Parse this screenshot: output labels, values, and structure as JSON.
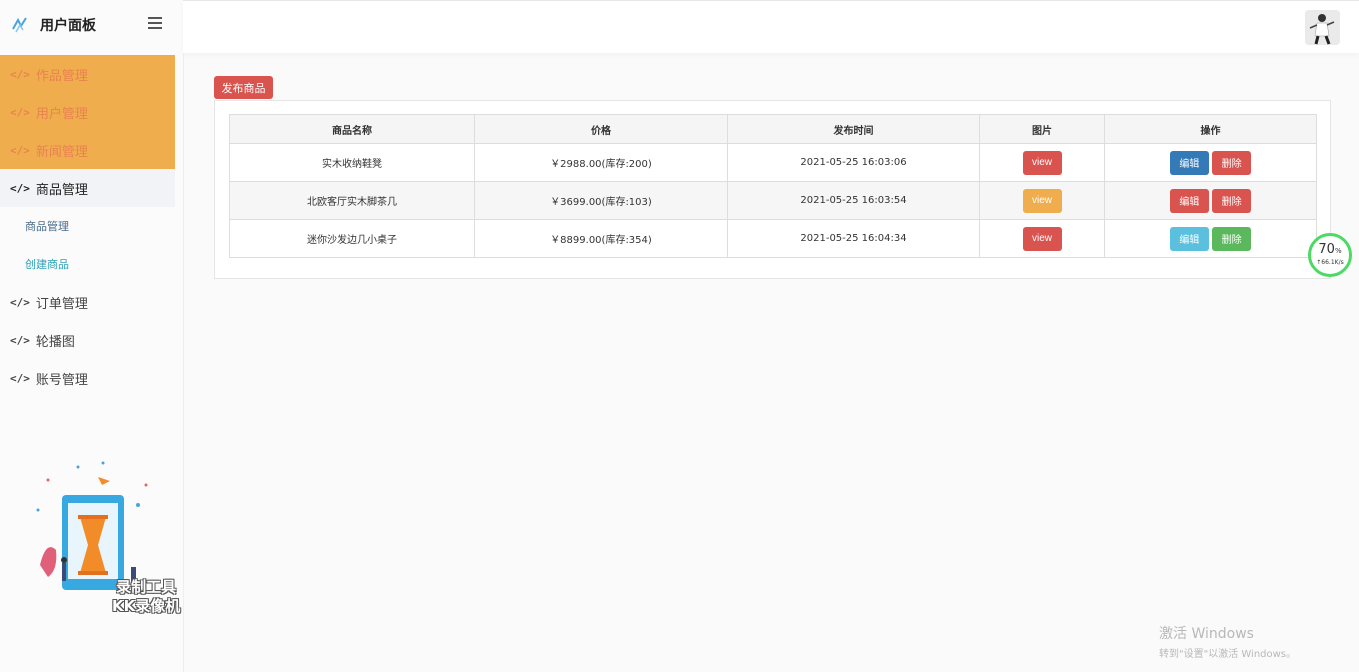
{
  "sidebar": {
    "brand_title": "用户面板",
    "items": [
      {
        "label": "作品管理"
      },
      {
        "label": "用户管理"
      },
      {
        "label": "新闻管理"
      },
      {
        "label": "商品管理"
      },
      {
        "label": "商品管理"
      },
      {
        "label": "创建商品"
      },
      {
        "label": "订单管理"
      },
      {
        "label": "轮播图"
      },
      {
        "label": "账号管理"
      }
    ],
    "watermark_line1": "录制工具",
    "watermark_line2": "KK录像机"
  },
  "toolbar": {
    "publish_label": "发布商品"
  },
  "table": {
    "headers": [
      "商品名称",
      "价格",
      "发布时间",
      "图片",
      "操作"
    ],
    "rows": [
      {
        "name": "实木收纳鞋凳",
        "price": "￥2988.00(库存:200)",
        "time": "2021-05-25 16:03:06",
        "view_label": "view",
        "edit_label": "编辑",
        "delete_label": "删除"
      },
      {
        "name": "北欧客厅实木脚茶几",
        "price": "￥3699.00(库存:103)",
        "time": "2021-05-25 16:03:54",
        "view_label": "view",
        "edit_label": "编辑",
        "delete_label": "删除"
      },
      {
        "name": "迷你沙发边几小桌子",
        "price": "￥8899.00(库存:354)",
        "time": "2021-05-25 16:04:34",
        "view_label": "view",
        "edit_label": "编辑",
        "delete_label": "删除"
      }
    ]
  },
  "speed_widget": {
    "percent": "70",
    "percent_unit": "%",
    "rate": "↑66.1K/s"
  },
  "windows": {
    "line1": "激活 Windows",
    "line2": "转到\"设置\"以激活 Windows。"
  },
  "colors": {
    "red": "#d9534f",
    "orange": "#f0ad4e",
    "blue": "#337ab7",
    "lightblue": "#5bc0de",
    "green": "#5cb85c",
    "accent": "#e8834e"
  }
}
